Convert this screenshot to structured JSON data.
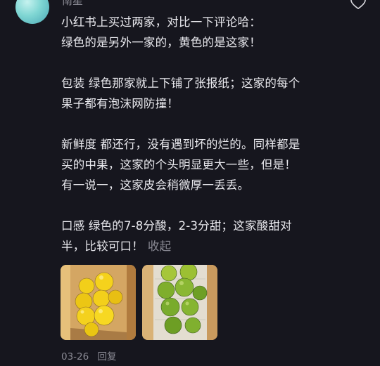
{
  "comment": {
    "username": "南星",
    "like_icon": "heart-outline-icon",
    "paragraphs": [
      [
        "小红书上买过两家，对比一下评论哈：",
        "绿色的是另外一家的，黄色的是这家！"
      ],
      [
        "包装 绿色那家就上下铺了张报纸；这家的每个",
        "果子都有泡沫网防撞！"
      ],
      [
        "新鲜度 都还行，没有遇到坏的烂的。同样都是",
        "买的中果，这家的个头明显更大一些，但是！",
        "有一说一，这家皮会稍微厚一丢丢。"
      ],
      [
        "口感 绿色的7-8分酸，2-3分甜；这家酸甜对",
        "半，比较可口！"
      ]
    ],
    "collapse_label": "收起",
    "date": "03-26",
    "reply_label": "回复"
  },
  "photos": [
    {
      "subject": "yellow-passion-fruit-in-box"
    },
    {
      "subject": "green-passion-fruit-in-box"
    }
  ]
}
